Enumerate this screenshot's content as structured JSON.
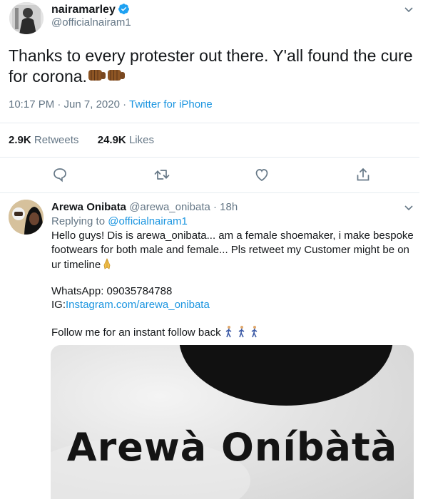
{
  "main_tweet": {
    "display_name": "nairamarley",
    "handle": "@officialnairam1",
    "text": "Thanks to every protester out there. Y'all found the cure for corona.",
    "time": "10:17 PM · Jun 7, 2020 · ",
    "source": "Twitter for iPhone",
    "retweets_count": "2.9K",
    "retweets_label": "Retweets",
    "likes_count": "24.9K",
    "likes_label": "Likes",
    "emoji": [
      "oncoming-fist",
      "oncoming-fist"
    ]
  },
  "reply_tweet": {
    "display_name": "Arewa Onibata",
    "meta": " @arewa_onibata · 18h",
    "replying_prefix": "Replying to ",
    "replying_to": "@officialnairam1",
    "line1": "Hello guys! Dis is arewa_onibata... am a female shoemaker, i make bespoke",
    "line2": "footwears for both male and female... Pls retweet my Customer might be on",
    "line3": "ur timeline",
    "whatsapp": "WhatsApp: 09035784788",
    "ig_prefix": "IG:",
    "ig_link": "Instagram.com/arewa_onibata",
    "follow": "Follow me for an instant follow back",
    "media_text": "Arewà Oníbàtà"
  },
  "actions": [
    "reply-icon",
    "retweet-icon",
    "like-icon",
    "share-icon"
  ],
  "colors": {
    "accent": "#1b95e0",
    "verified": "#1da1f2",
    "muted": "#657786"
  }
}
